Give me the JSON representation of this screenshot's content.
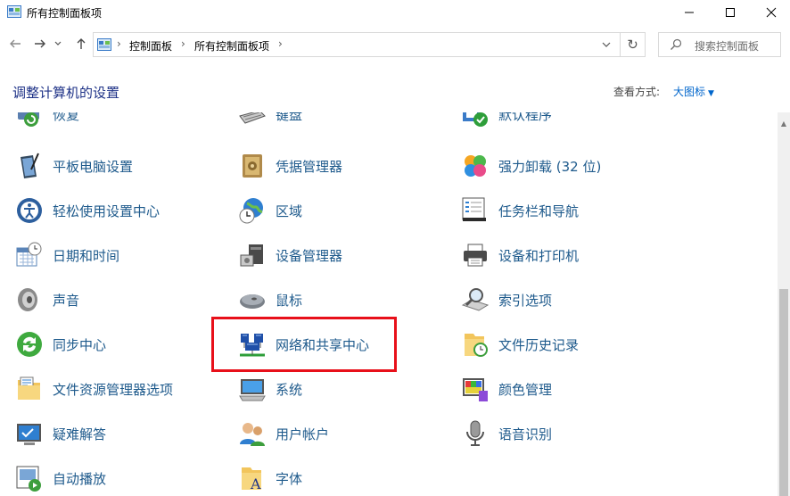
{
  "window": {
    "title": "所有控制面板项"
  },
  "address": {
    "crumbs": [
      "控制面板",
      "所有控制面板项"
    ],
    "separator": "›",
    "dropdown": "⌄",
    "refresh": "↻"
  },
  "search": {
    "placeholder": "搜索控制面板"
  },
  "header": {
    "title": "调整计算机的设置",
    "view_by_label": "查看方式:",
    "view_by_value": "大图标"
  },
  "items": [
    {
      "label": "恢复",
      "icon": "recovery-icon"
    },
    {
      "label": "键盘",
      "icon": "keyboard-icon"
    },
    {
      "label": "默认程序",
      "icon": "default-programs-icon"
    },
    {
      "label": "平板电脑设置",
      "icon": "tablet-icon"
    },
    {
      "label": "凭据管理器",
      "icon": "credential-icon"
    },
    {
      "label": "强力卸载 (32 位)",
      "icon": "uninstall-icon"
    },
    {
      "label": "轻松使用设置中心",
      "icon": "ease-of-access-icon"
    },
    {
      "label": "区域",
      "icon": "region-icon"
    },
    {
      "label": "任务栏和导航",
      "icon": "taskbar-icon"
    },
    {
      "label": "日期和时间",
      "icon": "date-time-icon"
    },
    {
      "label": "设备管理器",
      "icon": "device-manager-icon"
    },
    {
      "label": "设备和打印机",
      "icon": "printer-icon"
    },
    {
      "label": "声音",
      "icon": "sound-icon"
    },
    {
      "label": "鼠标",
      "icon": "mouse-icon"
    },
    {
      "label": "索引选项",
      "icon": "indexing-icon"
    },
    {
      "label": "同步中心",
      "icon": "sync-icon"
    },
    {
      "label": "网络和共享中心",
      "icon": "network-icon"
    },
    {
      "label": "文件历史记录",
      "icon": "file-history-icon"
    },
    {
      "label": "文件资源管理器选项",
      "icon": "folder-options-icon"
    },
    {
      "label": "系统",
      "icon": "system-icon"
    },
    {
      "label": "颜色管理",
      "icon": "color-management-icon"
    },
    {
      "label": "疑难解答",
      "icon": "troubleshoot-icon"
    },
    {
      "label": "用户帐户",
      "icon": "user-accounts-icon"
    },
    {
      "label": "语音识别",
      "icon": "speech-icon"
    },
    {
      "label": "自动播放",
      "icon": "autoplay-icon"
    },
    {
      "label": "字体",
      "icon": "fonts-icon"
    }
  ],
  "highlight_color": "#e8101a",
  "link_color": "#1e5a8c"
}
